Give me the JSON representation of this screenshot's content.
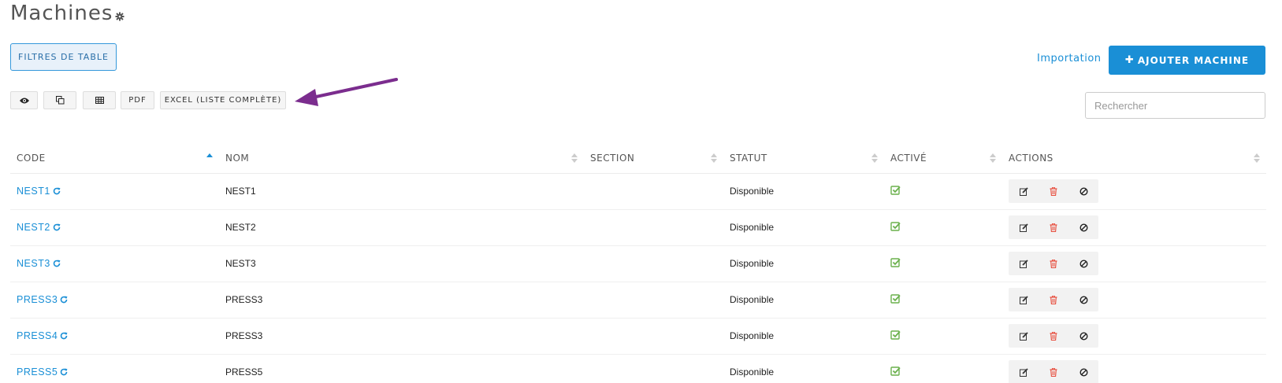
{
  "page": {
    "title": "Machines"
  },
  "toolbar": {
    "filters_label": "FILTRES DE TABLE",
    "import_label": "Importation",
    "add_label": "AJOUTER MACHINE",
    "pdf_label": "PDF",
    "excel_label": "EXCEL (LISTE COMPLÈTE)",
    "icon_buttons": [
      "eye-icon",
      "copy-icon",
      "table-icon"
    ]
  },
  "search": {
    "placeholder": "Rechercher",
    "value": ""
  },
  "table": {
    "columns": [
      "CODE",
      "NOM",
      "SECTION",
      "STATUT",
      "ACTIVÉ",
      "ACTIONS"
    ],
    "sort_column": "CODE",
    "rows": [
      {
        "code": "NEST1",
        "nom": "NEST1",
        "section": "",
        "statut": "Disponible"
      },
      {
        "code": "NEST2",
        "nom": "NEST2",
        "section": "",
        "statut": "Disponible"
      },
      {
        "code": "NEST3",
        "nom": "NEST3",
        "section": "",
        "statut": "Disponible"
      },
      {
        "code": "PRESS3",
        "nom": "PRESS3",
        "section": "",
        "statut": "Disponible"
      },
      {
        "code": "PRESS4",
        "nom": "PRESS3",
        "section": "",
        "statut": "Disponible"
      },
      {
        "code": "PRESS5",
        "nom": "PRESS5",
        "section": "",
        "statut": "Disponible"
      }
    ]
  },
  "colors": {
    "accent": "#1a8fd6",
    "check": "#6ab04c",
    "delete": "#e74c3c",
    "arrow": "#7b2d8e"
  }
}
